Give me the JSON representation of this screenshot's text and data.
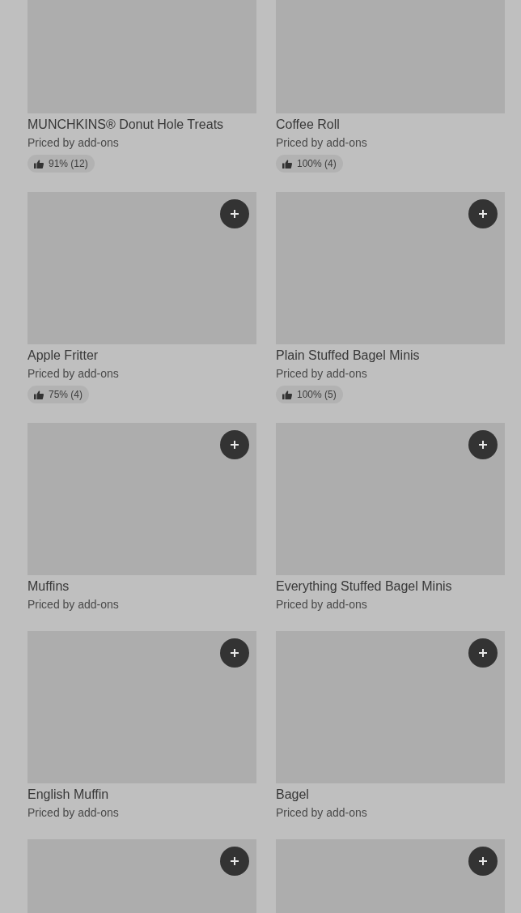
{
  "items": [
    {
      "name": "MUNCHKINS® Donut Hole Treats",
      "price": "Priced by add-ons",
      "rating": "91% (12)"
    },
    {
      "name": "Coffee Roll",
      "price": "Priced by add-ons",
      "rating": "100% (4)"
    },
    {
      "name": "Apple Fritter",
      "price": "Priced by add-ons",
      "rating": "75% (4)",
      "add_button": true
    },
    {
      "name": "Plain Stuffed Bagel Minis",
      "price": "Priced by add-ons",
      "rating": "100% (5)",
      "add_button": true
    },
    {
      "name": "Muffins",
      "price": "Priced by add-ons",
      "add_button": true
    },
    {
      "name": "Everything Stuffed Bagel Minis",
      "price": "Priced by add-ons",
      "add_button": true
    },
    {
      "name": "English Muffin",
      "price": "Priced by add-ons",
      "add_button": true
    },
    {
      "name": "Bagel",
      "price": "Priced by add-ons",
      "add_button": true
    },
    {
      "kind": "picture",
      "add_button": true
    },
    {
      "kind": "picture",
      "add_button": true
    }
  ]
}
